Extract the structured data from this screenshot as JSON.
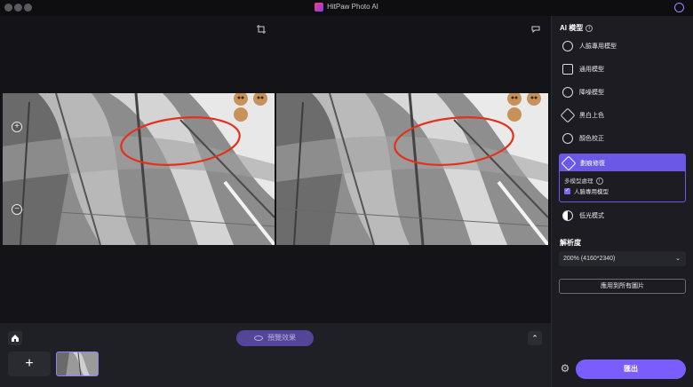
{
  "window": {
    "title": "HitPaw Photo AI"
  },
  "panel": {
    "title": "AI 模型",
    "models": [
      {
        "label": "人臉專用模型",
        "icon": "face-icon"
      },
      {
        "label": "通用模型",
        "icon": "image-icon"
      },
      {
        "label": "降噪模型",
        "icon": "denoise-icon"
      },
      {
        "label": "黑白上色",
        "icon": "colorize-icon"
      },
      {
        "label": "顏色校正",
        "icon": "brightness-icon"
      }
    ],
    "active_model": {
      "label": "劃痕修復",
      "icon": "scratch-repair-icon",
      "multi_label": "多模型處理",
      "checkbox_label": "人臉專用模型",
      "checked": true
    },
    "low_light": {
      "label": "低光模式",
      "icon": "half-circle-icon"
    },
    "resolution_title": "解析度",
    "resolution_value": "200% (4160*2340)",
    "apply_all_label": "應用到所有圖片",
    "export_label": "匯出"
  },
  "bottom": {
    "preview_label": "預覽效果"
  },
  "colors": {
    "accent": "#7b5cff",
    "highlight": "#e2321c"
  }
}
